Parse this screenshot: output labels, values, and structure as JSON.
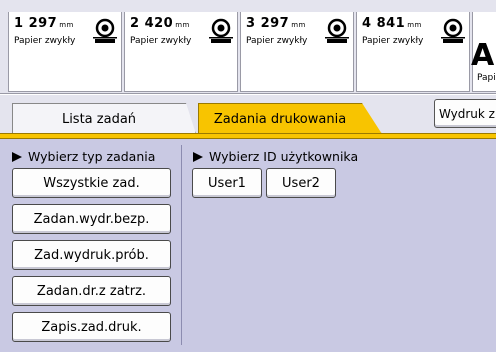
{
  "trays": [
    {
      "size": "1 297",
      "unit": "mm",
      "paper_type": "Papier zwykły",
      "icon": "paper-tray-icon"
    },
    {
      "size": "2 420",
      "unit": "mm",
      "paper_type": "Papier zwykły",
      "icon": "paper-tray-icon"
    },
    {
      "size": "3 297",
      "unit": "mm",
      "paper_type": "Papier zwykły",
      "icon": "paper-tray-icon"
    },
    {
      "size": "4 841",
      "unit": "mm",
      "paper_type": "Papier zwykły",
      "icon": "paper-tray-icon"
    }
  ],
  "bypass_tray": {
    "letter": "A",
    "label": "Papi"
  },
  "tabs": {
    "job_list": "Lista zadań",
    "print_jobs": "Zadania drukowania"
  },
  "print_button_label": "Wydruk z u",
  "job_type": {
    "heading": "Wybierz typ zadania",
    "buttons": [
      "Wszystkie zad.",
      "Zadan.wydr.bezp.",
      "Zad.wydruk.prób.",
      "Zadan.dr.z zatrz.",
      "Zapis.zad.druk."
    ]
  },
  "user_id": {
    "heading": "Wybierz ID użytkownika",
    "users": [
      "User1",
      "User2"
    ]
  },
  "colors": {
    "accent": "#f8c400",
    "panel": "#c9c9e3",
    "tray_bg": "#e4e4ee"
  }
}
